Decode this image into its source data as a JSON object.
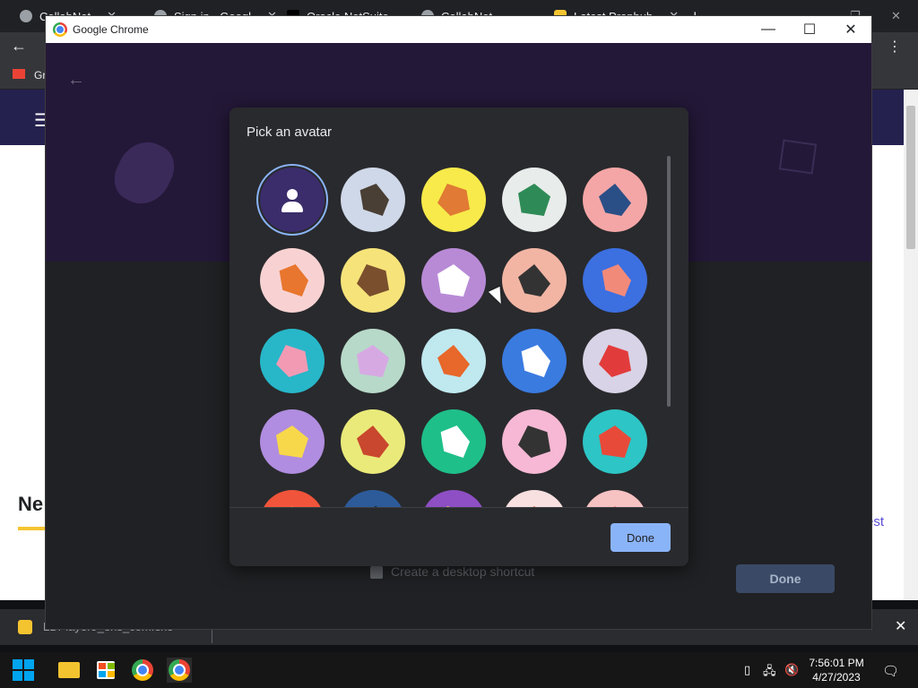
{
  "bg_browser": {
    "tabs": [
      "CollabNet",
      "Sign in - Googl",
      "Oracle NetSuite",
      "CollabNet",
      "Latest Propbub"
    ],
    "bookmark_first": "Gr",
    "heading_fragment": "Ne",
    "link_fragment": "est",
    "download_name": "LDPlayer9_ens_com.exe"
  },
  "window": {
    "title": "Google Chrome",
    "minimize": "—",
    "maximize": "☐",
    "close": "✕"
  },
  "picker": {
    "checkbox_label": "Create a desktop shortcut",
    "done_label": "Done"
  },
  "dialog": {
    "title": "Pick an avatar",
    "done_label": "Done",
    "avatars": [
      {
        "name": "generic-person",
        "bg": "#3b2d6b",
        "accent": "#ffffff",
        "selected": true
      },
      {
        "name": "cat",
        "bg": "#cfd8e8",
        "accent": "#4a3f35"
      },
      {
        "name": "corgi",
        "bg": "#f7ea4a",
        "accent": "#e07a34"
      },
      {
        "name": "dragon",
        "bg": "#e8ecea",
        "accent": "#2e8b57"
      },
      {
        "name": "elephant",
        "bg": "#f4a6a6",
        "accent": "#2a4f86"
      },
      {
        "name": "fox",
        "bg": "#f8d2d2",
        "accent": "#e8762f"
      },
      {
        "name": "monkey",
        "bg": "#f6e37a",
        "accent": "#7a4f2e"
      },
      {
        "name": "panda",
        "bg": "#b88ad6",
        "accent": "#ffffff"
      },
      {
        "name": "penguin",
        "bg": "#f2b5a4",
        "accent": "#333333"
      },
      {
        "name": "butterfly",
        "bg": "#3c6fe0",
        "accent": "#f28a7a"
      },
      {
        "name": "rabbit",
        "bg": "#27b7c9",
        "accent": "#f29ab4"
      },
      {
        "name": "unicorn",
        "bg": "#b7d9c9",
        "accent": "#d7a9e3"
      },
      {
        "name": "basketball",
        "bg": "#bfe8ef",
        "accent": "#e8672a"
      },
      {
        "name": "bicycle",
        "bg": "#3a7be0",
        "accent": "#ffffff"
      },
      {
        "name": "bird",
        "bg": "#d8d3e6",
        "accent": "#e23b3b"
      },
      {
        "name": "cheese",
        "bg": "#b08de0",
        "accent": "#f7d84a"
      },
      {
        "name": "football",
        "bg": "#eaea7a",
        "accent": "#c9472e"
      },
      {
        "name": "ramen",
        "bg": "#1fbf8a",
        "accent": "#ffffff"
      },
      {
        "name": "sunglasses",
        "bg": "#f6b8d4",
        "accent": "#333333"
      },
      {
        "name": "sushi",
        "bg": "#2dc5c5",
        "accent": "#e84a3a"
      },
      {
        "name": "avatar-21",
        "bg": "#f0543a",
        "accent": "#f4a13a"
      },
      {
        "name": "avatar-22",
        "bg": "#2d5b9a",
        "accent": "#101010"
      },
      {
        "name": "avatar-23",
        "bg": "#8e4fc4",
        "accent": "#f2d44a"
      },
      {
        "name": "avatar-24",
        "bg": "#f8e0e0",
        "accent": "#e8572e"
      },
      {
        "name": "avatar-25",
        "bg": "#f7c2c2",
        "accent": "#e84a4a"
      }
    ]
  },
  "taskbar": {
    "time": "7:56:01 PM",
    "date": "4/27/2023"
  },
  "colors": {
    "accent": "#8ab4f8",
    "dialog_bg": "#292a2d",
    "window_top": "#241838"
  }
}
